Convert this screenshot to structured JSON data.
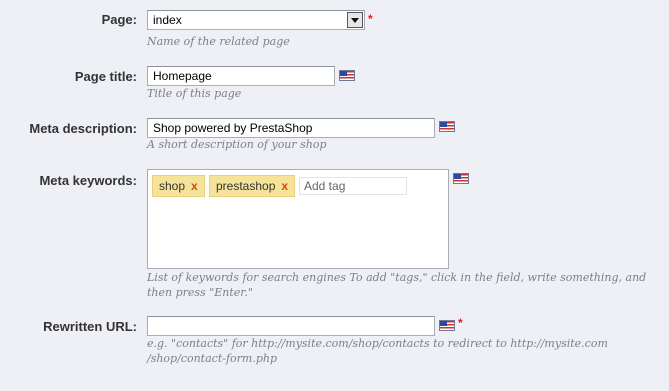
{
  "fields": {
    "page": {
      "label": "Page:",
      "value": "index",
      "hint": "Name of the related page",
      "required_mark": "*"
    },
    "page_title": {
      "label": "Page title:",
      "value": "Homepage",
      "hint": "Title of this page",
      "language_icon": "us-flag-icon"
    },
    "meta_description": {
      "label": "Meta description:",
      "value": "Shop powered by PrestaShop",
      "hint": "A short description of your shop",
      "language_icon": "us-flag-icon"
    },
    "meta_keywords": {
      "label": "Meta keywords:",
      "tags": [
        {
          "text": "shop",
          "remove": "x"
        },
        {
          "text": "prestashop",
          "remove": "x"
        }
      ],
      "add_placeholder": "Add tag",
      "hint_line1": "List of keywords for search engines To add \"tags,\" click in the field, write something, and",
      "hint_line2": "then press \"Enter.\"",
      "language_icon": "us-flag-icon"
    },
    "rewritten_url": {
      "label": "Rewritten URL:",
      "value": "",
      "hint_line1": "e.g. \"contacts\" for http://mysite.com/shop/contacts to redirect to http://mysite.com",
      "hint_line2": "/shop/contact-form.php",
      "required_mark": "*",
      "language_icon": "us-flag-icon"
    }
  },
  "colors": {
    "background": "#eef0f6",
    "required": "#e02020",
    "tag_background": "#f6e39a",
    "tag_remove": "#d24a0e",
    "hint": "#7b7f86"
  }
}
